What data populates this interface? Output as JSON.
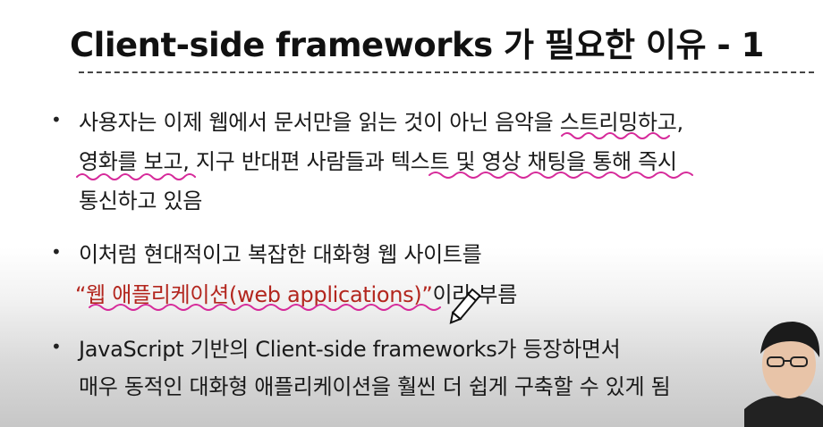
{
  "slide": {
    "title": "Client-side frameworks 가 필요한 이유 - 1",
    "bullets": [
      {
        "lines": [
          "사용자는 이제 웹에서 문서만을 읽는 것이 아닌 음악을 스트리밍하고,",
          "영화를 보고, 지구 반대편 사람들과 텍스트 및 영상 채팅을 통해 즉시",
          "통신하고 있음"
        ]
      },
      {
        "line1": "이처럼 현대적이고 복잡한 대화형 웹 사이트를",
        "highlight": "“웹 애플리케이션(web applications)”",
        "suffix": "이라 부름"
      },
      {
        "lines": [
          "JavaScript 기반의 Client-side frameworks가 등장하면서",
          "매우 동적인 대화형 애플리케이션을 훨씬 더 쉽게 구축할 수 있게 됨"
        ]
      }
    ],
    "bullet_symbol": "•"
  },
  "colors": {
    "annotation": "#d62a9a",
    "highlight_text": "#b3261e"
  },
  "icons": {
    "cursor": "pencil-cursor-icon"
  }
}
